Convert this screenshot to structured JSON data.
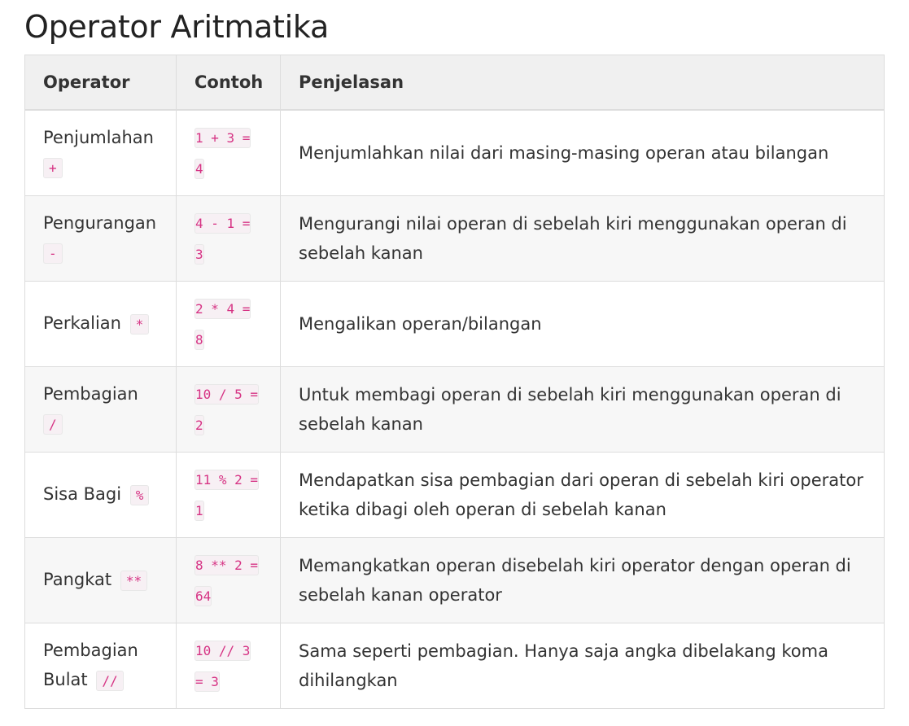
{
  "title": "Operator Aritmatika",
  "table": {
    "headers": [
      "Operator",
      "Contoh",
      "Penjelasan"
    ],
    "rows": [
      {
        "name": "Penjumlahan",
        "symbol": "+",
        "example": "1 + 3 = 4",
        "description": "Menjumlahkan nilai dari masing-masing operan atau bilangan"
      },
      {
        "name": "Pengurangan",
        "symbol": "-",
        "example": "4 - 1 = 3",
        "description": "Mengurangi nilai operan di sebelah kiri menggunakan operan di sebelah kanan"
      },
      {
        "name": "Perkalian",
        "symbol": "*",
        "example": "2 * 4 = 8",
        "description": "Mengalikan operan/bilangan"
      },
      {
        "name": "Pembagian",
        "symbol": "/",
        "example": "10 / 5 = 2",
        "description": "Untuk membagi operan di sebelah kiri menggunakan operan di sebelah kanan"
      },
      {
        "name": "Sisa Bagi",
        "symbol": "%",
        "example": "11 % 2 = 1",
        "description": "Mendapatkan sisa pembagian dari operan di sebelah kiri operator ketika dibagi oleh operan di sebelah kanan"
      },
      {
        "name": "Pangkat",
        "symbol": "**",
        "example": "8 ** 2 = 64",
        "description": "Memangkatkan operan disebelah kiri operator dengan operan di sebelah kanan operator"
      },
      {
        "name": "Pembagian Bulat",
        "symbol": "//",
        "example": "10 // 3 = 3",
        "description": "Sama seperti pembagian. Hanya saja angka dibelakang koma dihilangkan"
      }
    ]
  },
  "colors": {
    "code_text": "#d63384",
    "header_bg": "#f0f0f0",
    "stripe_bg": "#f7f7f7",
    "border": "#dddddd"
  }
}
